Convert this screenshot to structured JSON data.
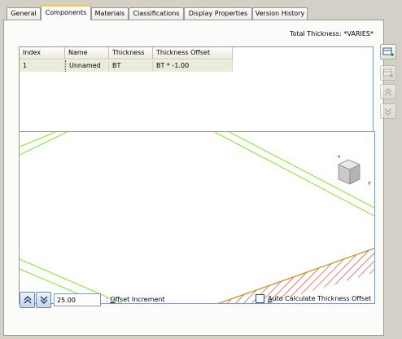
{
  "tabs": [
    {
      "label": "General",
      "active": false
    },
    {
      "label": "Components",
      "active": true
    },
    {
      "label": "Materials",
      "active": false
    },
    {
      "label": "Classifications",
      "active": false
    },
    {
      "label": "Display Properties",
      "active": false
    },
    {
      "label": "Version History",
      "active": false
    }
  ],
  "total_thickness": {
    "label": "Total Thickness:",
    "value": "*VARIES*"
  },
  "grid": {
    "columns": [
      "Index",
      "Name",
      "Thickness",
      "Thickness Offset"
    ],
    "rows": [
      {
        "index": "1",
        "name": "Unnamed",
        "thickness": "BT",
        "offset": "BT * -1.00"
      }
    ]
  },
  "side_buttons": [
    {
      "icon": "add-component-icon",
      "enabled": true
    },
    {
      "icon": "remove-component-icon",
      "enabled": false
    },
    {
      "icon": "move-up-icon",
      "enabled": false
    },
    {
      "icon": "move-down-icon",
      "enabled": false
    }
  ],
  "viewport": {
    "line_color": "#7fe62a",
    "hatch_color": "#c0392b",
    "view_cube_icon": "view-cube-icon"
  },
  "bottom": {
    "increment_up_icon": "chevron-double-up-icon",
    "increment_down_icon": "chevron-double-down-icon",
    "offset_value": "25.00",
    "offset_label_prefix": ": ",
    "offset_label_accel": "O",
    "offset_label_rest": "ffset Increment",
    "auto_accel": "A",
    "auto_rest": "uto Calculate Thickness Offset",
    "auto_checked": false
  }
}
